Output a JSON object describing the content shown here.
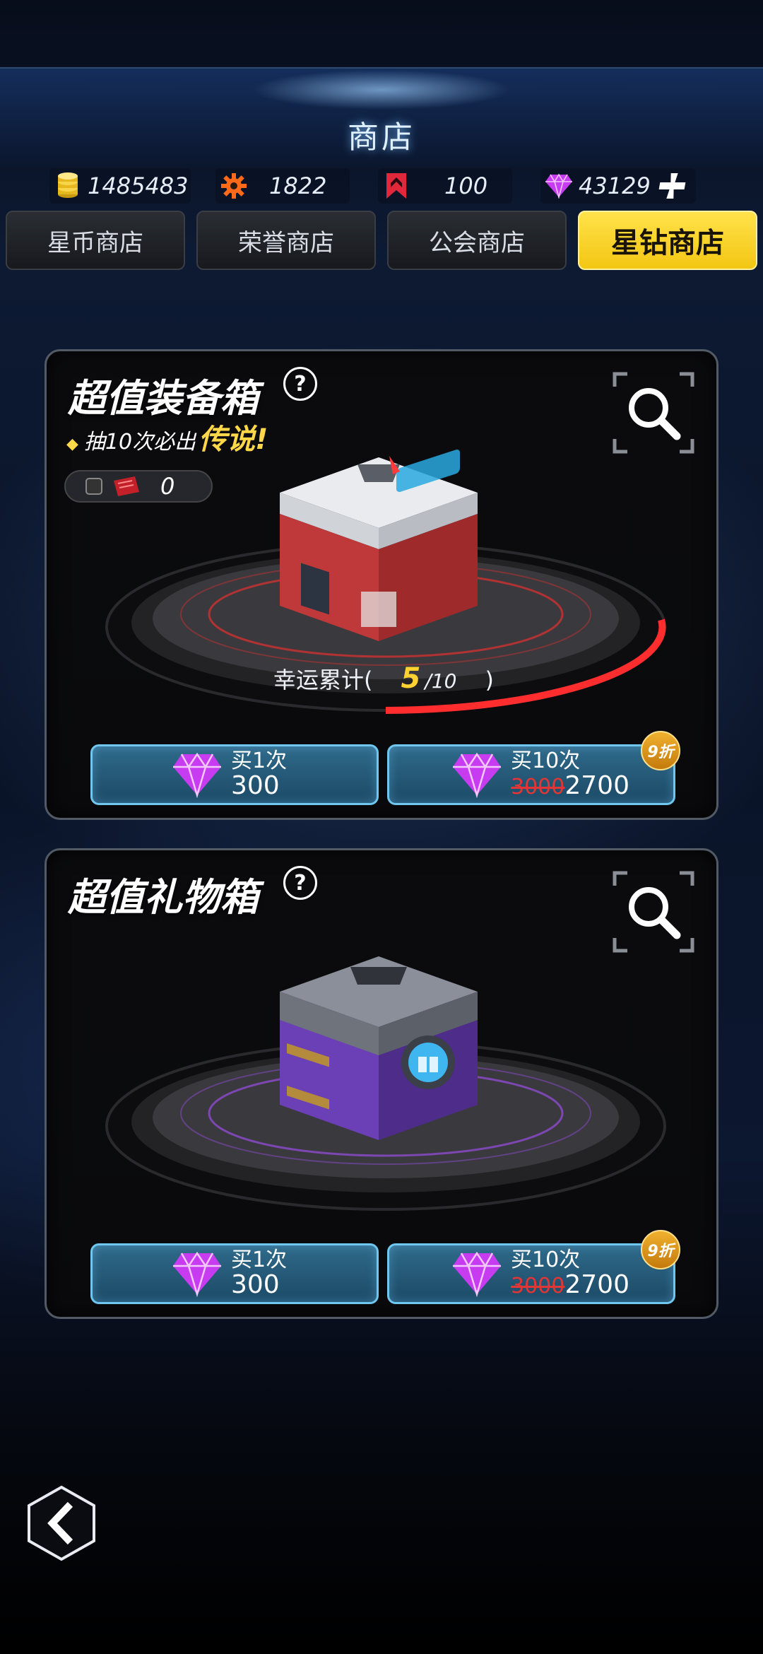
{
  "header": {
    "title": "商店"
  },
  "currencies": {
    "coins": "1485483",
    "honor": "1822",
    "guild": "100",
    "gems": "43129"
  },
  "tabs": [
    {
      "label": "星币商店",
      "active": false
    },
    {
      "label": "荣誉商店",
      "active": false
    },
    {
      "label": "公会商店",
      "active": false
    },
    {
      "label": "星钻商店",
      "active": true
    }
  ],
  "cards": [
    {
      "title": "超值装备箱",
      "help": "?",
      "subtitle_prefix": "抽10次必出",
      "subtitle_highlight": "传说!",
      "ticket_count": "0",
      "luck_label": "幸运累计(",
      "luck_current": "5",
      "luck_total": "/10",
      "luck_close": ")",
      "luck_progress": 0.5,
      "buy1": {
        "label": "买1次",
        "price": "300"
      },
      "buy10": {
        "label": "买10次",
        "old_price": "3000",
        "price": "2700",
        "discount": "9折"
      }
    },
    {
      "title": "超值礼物箱",
      "help": "?",
      "buy1": {
        "label": "买1次",
        "price": "300"
      },
      "buy10": {
        "label": "买10次",
        "old_price": "3000",
        "price": "2700",
        "discount": "9折"
      }
    }
  ],
  "colors": {
    "gem": "#c73cf0",
    "tab_active": "#f7d22a",
    "button_border": "#6fc7ef",
    "discount": "#e89a1c",
    "strike": "#e23535",
    "luck_ring": "#ff2d2d"
  }
}
